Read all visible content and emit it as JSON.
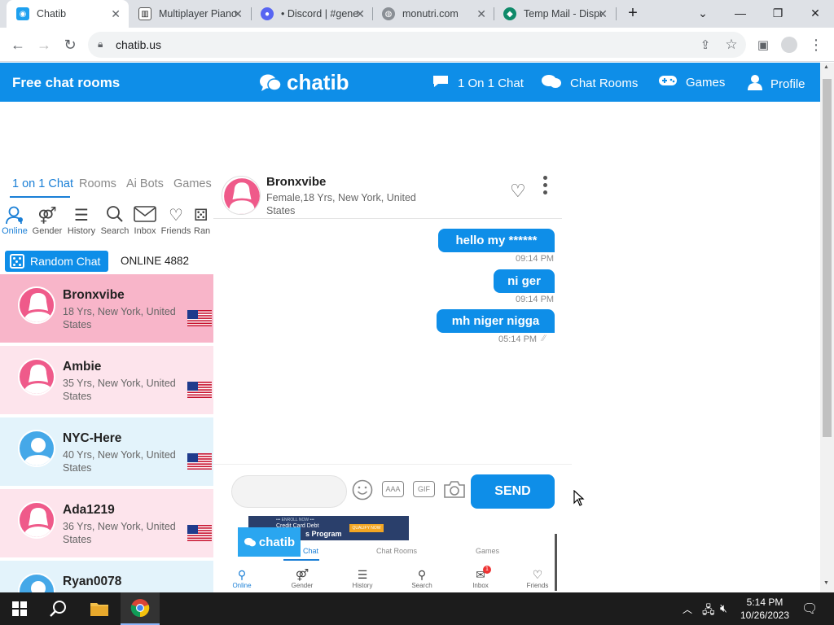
{
  "browser": {
    "tabs": [
      {
        "title": "Chatib",
        "active": true
      },
      {
        "title": "Multiplayer Piano",
        "active": false
      },
      {
        "title": "• Discord | #general",
        "active": false
      },
      {
        "title": "monutri.com",
        "active": false
      },
      {
        "title": "Temp Mail - Disposable",
        "active": false
      }
    ],
    "url": "chatib.us"
  },
  "header": {
    "left_title": "Free chat rooms",
    "logo_text": "chatib",
    "nav": [
      {
        "label": "1 On 1 Chat",
        "icon": "speech-bubble-icon"
      },
      {
        "label": "Chat Rooms",
        "icon": "chat-bubbles-icon"
      },
      {
        "label": "Games",
        "icon": "gamepad-icon"
      },
      {
        "label": "Profile",
        "icon": "person-icon"
      }
    ]
  },
  "left": {
    "tabs": [
      "1 on 1 Chat",
      "Rooms",
      "Ai Bots",
      "Games"
    ],
    "icons": [
      "Online",
      "Gender",
      "History",
      "Search",
      "Inbox",
      "Friends",
      "Ran"
    ],
    "random_chat_label": "Random Chat",
    "online_label": "ONLINE 4882",
    "users": [
      {
        "name": "Bronxvibe",
        "info": "18 Yrs, New York, United States",
        "gender": "female"
      },
      {
        "name": "Ambie",
        "info": "35 Yrs, New York, United States",
        "gender": "female"
      },
      {
        "name": "NYC-Here",
        "info": "40 Yrs, New York, United States",
        "gender": "male"
      },
      {
        "name": "Ada1219",
        "info": "36 Yrs, New York, United States",
        "gender": "female"
      },
      {
        "name": "Ryan0078",
        "info": "",
        "gender": "male"
      }
    ]
  },
  "chat": {
    "name": "Bronxvibe",
    "info": "Female,18 Yrs, New York, United States",
    "messages": [
      {
        "text": "hello my ******",
        "time": "09:14 PM"
      },
      {
        "text": "ni ger",
        "time": "09:14 PM"
      },
      {
        "text": "mh niger nigga",
        "time": "05:14 PM"
      }
    ],
    "input_placeholder": "",
    "aaa_label": "AAA",
    "gif_label": "GIF",
    "send_label": "SEND"
  },
  "preview": {
    "logo": "chatib",
    "banner_line1": "••• ENROLL NOW •••",
    "banner_line2": "Credit Card Debt",
    "banner_line3": "s Program",
    "banner_cta": "QUALIFY NOW",
    "tabs": [
      "Chat",
      "Chat Rooms",
      "Games"
    ],
    "bottom": [
      "Online",
      "Gender",
      "History",
      "Search",
      "Inbox",
      "Friends"
    ],
    "inbox_badge": "1"
  },
  "taskbar": {
    "time": "5:14 PM",
    "date": "10/26/2023"
  },
  "colors": {
    "brand": "#0e8ee8",
    "female_row": "#fde4ec",
    "female_row_active": "#f8b5c9",
    "male_row": "#e3f3fb",
    "female_avatar": "#ef5a8a",
    "male_avatar": "#45a8e8"
  }
}
